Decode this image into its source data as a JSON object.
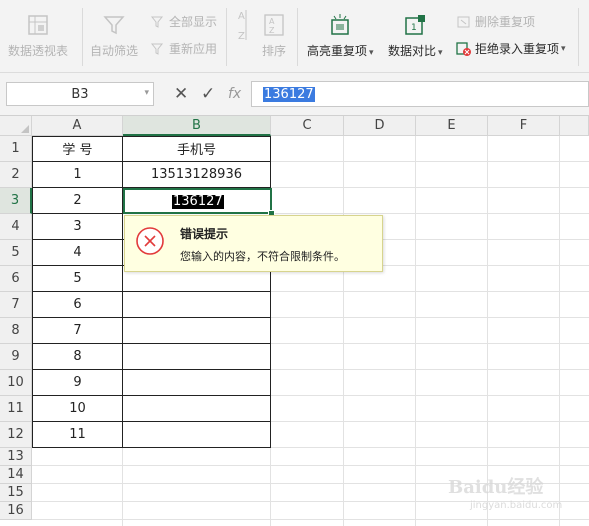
{
  "ribbon": {
    "pivot_table": "数据透视表",
    "auto_filter": "自动筛选",
    "show_all": "全部显示",
    "reapply": "重新应用",
    "sort": "排序",
    "highlight_duplicates": "高亮重复项",
    "data_compare": "数据对比",
    "delete_duplicates": "删除重复项",
    "reject_duplicates": "拒绝录入重复项"
  },
  "formula_bar": {
    "name_box": "B3",
    "fx_label": "fx",
    "value": "136127"
  },
  "columns": [
    "A",
    "B",
    "C",
    "D",
    "E",
    "F"
  ],
  "rows": [
    "1",
    "2",
    "3",
    "4",
    "5",
    "6",
    "7",
    "8",
    "9",
    "10",
    "11",
    "12",
    "13",
    "14",
    "15",
    "16"
  ],
  "table": {
    "headers": [
      "学  号",
      "手机号"
    ],
    "rows": [
      {
        "a": "1",
        "b": "13513128936"
      },
      {
        "a": "2",
        "b": "136127"
      },
      {
        "a": "3",
        "b": ""
      },
      {
        "a": "4",
        "b": ""
      },
      {
        "a": "5",
        "b": ""
      },
      {
        "a": "6",
        "b": ""
      },
      {
        "a": "7",
        "b": ""
      },
      {
        "a": "8",
        "b": ""
      },
      {
        "a": "9",
        "b": ""
      },
      {
        "a": "10",
        "b": ""
      },
      {
        "a": "11",
        "b": ""
      }
    ]
  },
  "error_tooltip": {
    "title": "错误提示",
    "message": "您输入的内容，不符合限制条件。"
  },
  "watermark": {
    "text": "Baidu经验",
    "sub": "jingyan.baidu.com"
  },
  "colors": {
    "accent_green": "#217346",
    "error_red": "#e23b3b",
    "tooltip_bg": "#ffffe1"
  }
}
